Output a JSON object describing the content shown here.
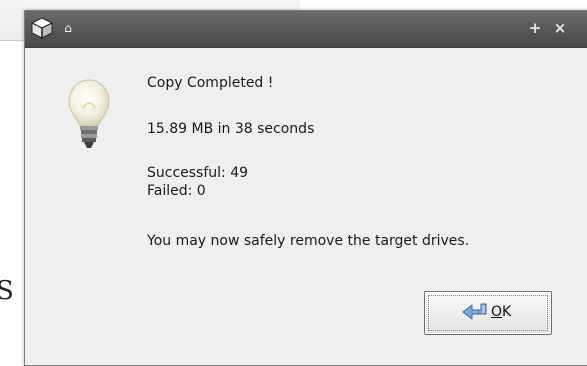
{
  "background": {
    "partial_text": "S"
  },
  "window": {
    "titlebar_buttons": {
      "pin_icon": "pin-icon",
      "close_icon": "close-icon"
    }
  },
  "dialog": {
    "title": "Copy Completed !",
    "size_line": "15.89 MB in 38 seconds",
    "successful": "Successful: 49",
    "failed": "Failed: 0",
    "note": "You may now safely remove the target drives.",
    "ok_button": {
      "mnemonic": "O",
      "rest": "K"
    }
  }
}
